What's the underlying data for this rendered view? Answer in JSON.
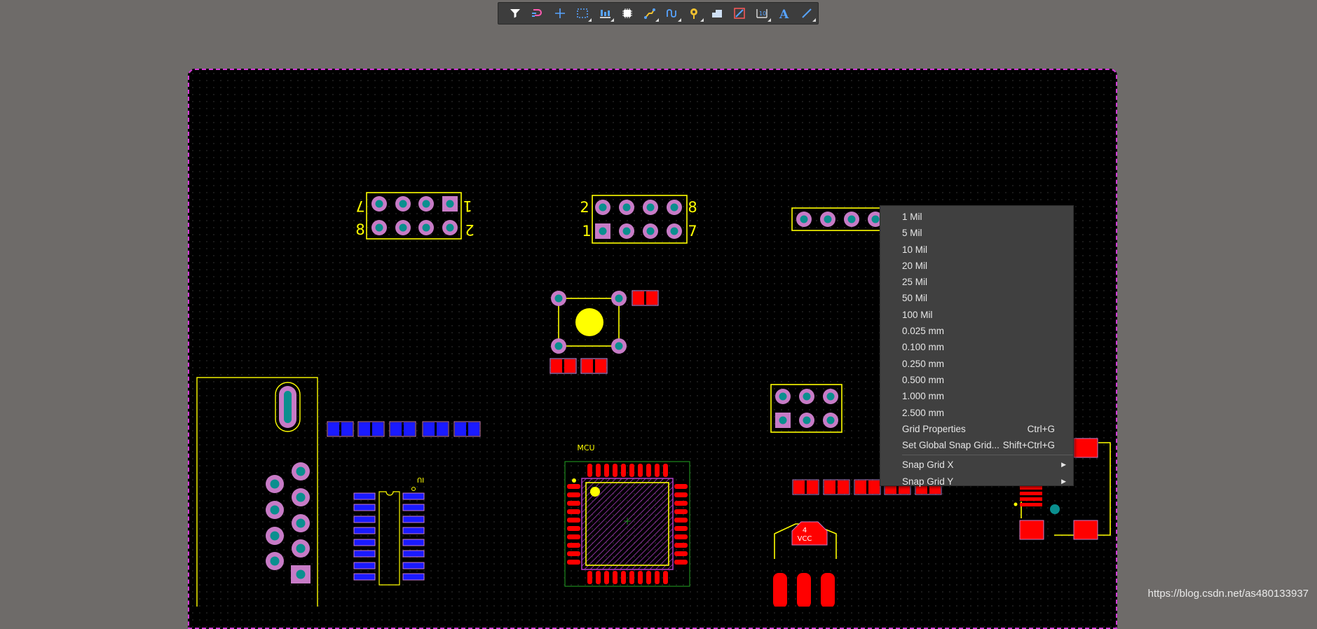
{
  "toolbar": {
    "buttons": [
      {
        "icon": "filter-icon",
        "name": "filter-button"
      },
      {
        "icon": "route-icon",
        "name": "interactive-route-button"
      },
      {
        "icon": "crosshair-icon",
        "name": "place-crosshair-button"
      },
      {
        "icon": "select-rect-icon",
        "name": "select-rectangle-button"
      },
      {
        "icon": "align-icon",
        "name": "align-button"
      },
      {
        "icon": "component-icon",
        "name": "place-component-button"
      },
      {
        "icon": "track-icon",
        "name": "interactive-routing-button"
      },
      {
        "icon": "diff-pair-icon",
        "name": "diff-pair-routing-button"
      },
      {
        "icon": "via-icon",
        "name": "place-via-button"
      },
      {
        "icon": "polygon-icon",
        "name": "place-polygon-button"
      },
      {
        "icon": "length-tune-icon",
        "name": "length-tuning-button"
      },
      {
        "icon": "dimension-icon",
        "name": "place-dimension-button"
      },
      {
        "icon": "text-icon",
        "name": "place-text-button",
        "label": "A"
      },
      {
        "icon": "line-icon",
        "name": "place-line-button"
      }
    ]
  },
  "pcb": {
    "labels": {
      "j1_top_left": "7",
      "j1_top_right": "1",
      "j1_bottom_left": "8",
      "j1_bottom_right": "2",
      "j2_top_left": "2",
      "j2_top_right": "8",
      "j2_bottom_left": "1",
      "j2_bottom_right": "7",
      "mcu": "MCU",
      "u1": "IU",
      "vcc_num": "4",
      "vcc": "VCC"
    },
    "colors": {
      "board": "#000000",
      "outline": "#d43ad8",
      "silkscreen": "#ffff00",
      "pad_top": "#ff0000",
      "pad_bottom": "#1a1aff",
      "via_ring": "#c77bc6",
      "via_hole": "#0a8f8f"
    }
  },
  "context_menu": {
    "grid_items": [
      "1 Mil",
      "5 Mil",
      "10 Mil",
      "20 Mil",
      "25 Mil",
      "50 Mil",
      "100 Mil",
      "0.025 mm",
      "0.100 mm",
      "0.250 mm",
      "0.500 mm",
      "1.000 mm",
      "2.500 mm"
    ],
    "grid_properties": {
      "label": "Grid Properties",
      "shortcut": "Ctrl+G"
    },
    "set_global": {
      "label": "Set Global Snap Grid...",
      "shortcut": "Shift+Ctrl+G"
    },
    "snap_x": {
      "label": "Snap Grid X"
    },
    "snap_y": {
      "label": "Snap Grid Y"
    }
  },
  "watermark": "https://blog.csdn.net/as480133937"
}
